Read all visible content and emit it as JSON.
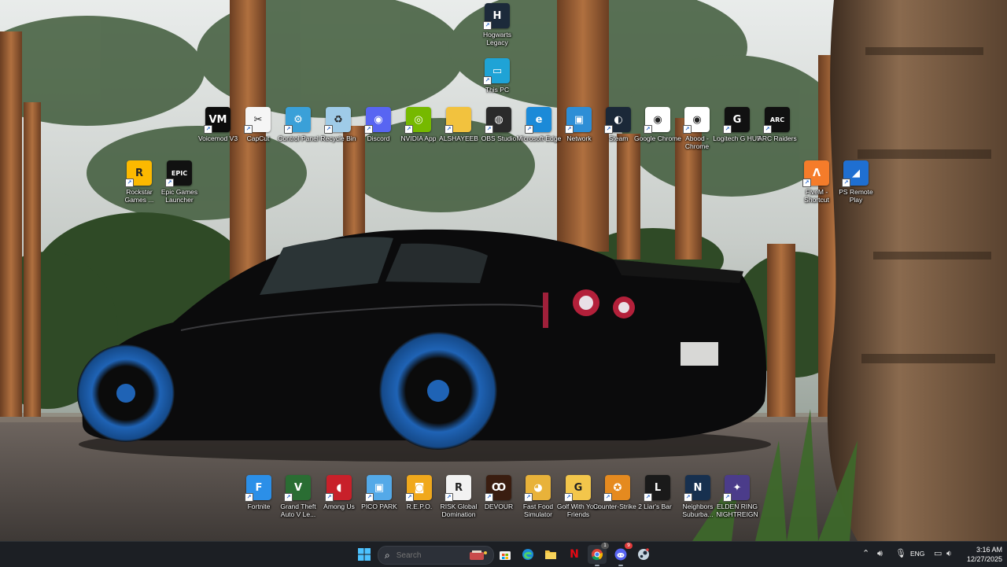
{
  "desktop": {
    "icons": [
      {
        "label": "Hogwarts Legacy",
        "icon": "hogwarts-icon",
        "color": "#1c2a3a",
        "glyph": "H"
      },
      {
        "label": "This PC",
        "icon": "monitor-icon",
        "color": "#1fa3d6",
        "glyph": "▭"
      },
      {
        "label": "Voicemod V3",
        "icon": "voicemod-icon",
        "color": "#0c0c0c",
        "glyph": "VM"
      },
      {
        "label": "CapCut",
        "icon": "capcut-icon",
        "color": "#f5f5f5",
        "glyph": "✂"
      },
      {
        "label": "Control Panel",
        "icon": "control-panel-icon",
        "color": "#3aa0d8",
        "glyph": "⚙"
      },
      {
        "label": "Recycle Bin",
        "icon": "recycle-bin-icon",
        "color": "#9fcbe8",
        "glyph": "♻"
      },
      {
        "label": "Discord",
        "icon": "discord-icon",
        "color": "#5865f2",
        "glyph": "◉"
      },
      {
        "label": "NVIDIA App",
        "icon": "nvidia-icon",
        "color": "#76b900",
        "glyph": "◎"
      },
      {
        "label": "ALSHAYEEB",
        "icon": "folder-icon",
        "color": "#f2c23e",
        "glyph": ""
      },
      {
        "label": "OBS Studio",
        "icon": "obs-icon",
        "color": "#2a2a2a",
        "glyph": "◍"
      },
      {
        "label": "Microsoft Edge",
        "icon": "edge-icon",
        "color": "#1b8ad8",
        "glyph": "e"
      },
      {
        "label": "Network",
        "icon": "network-icon",
        "color": "#2d8ed6",
        "glyph": "▣"
      },
      {
        "label": "Steam",
        "icon": "steam-icon",
        "color": "#1b2838",
        "glyph": "◐"
      },
      {
        "label": "Google Chrome",
        "icon": "chrome-icon",
        "color": "#ffffff",
        "glyph": "◉"
      },
      {
        "label": "Abood - Chrome",
        "icon": "chrome-profile-icon",
        "color": "#ffffff",
        "glyph": "◉"
      },
      {
        "label": "Logitech G HUB",
        "icon": "logitech-icon",
        "color": "#111111",
        "glyph": "G"
      },
      {
        "label": "ARC Raiders",
        "icon": "arc-raiders-icon",
        "color": "#101010",
        "glyph": "ARC"
      },
      {
        "label": "Rockstar Games ...",
        "icon": "rockstar-icon",
        "color": "#fcb900",
        "glyph": "R"
      },
      {
        "label": "Epic Games Launcher",
        "icon": "epic-games-icon",
        "color": "#111111",
        "glyph": "EPIC"
      },
      {
        "label": "FiveM - Shortcut",
        "icon": "fivem-icon",
        "color": "#f57c2a",
        "glyph": "Λ"
      },
      {
        "label": "PS Remote Play",
        "icon": "ps-remote-play-icon",
        "color": "#1f6fd1",
        "glyph": "◢"
      }
    ],
    "games": [
      {
        "label": "Fortnite",
        "icon": "fortnite-icon",
        "color": "#2b8fe8",
        "glyph": "F"
      },
      {
        "label": "Grand Theft Auto V Le...",
        "icon": "gta-v-icon",
        "color": "#2a6d33",
        "glyph": "V"
      },
      {
        "label": "Among Us",
        "icon": "among-us-icon",
        "color": "#c8202a",
        "glyph": "◖"
      },
      {
        "label": "PICO PARK",
        "icon": "pico-park-icon",
        "color": "#54a9e8",
        "glyph": "▣"
      },
      {
        "label": "R.E.P.O.",
        "icon": "repo-icon",
        "color": "#f0a81c",
        "glyph": "◙"
      },
      {
        "label": "RISK Global Domination",
        "icon": "risk-icon",
        "color": "#f2f2f2",
        "glyph": "R"
      },
      {
        "label": "DEVOUR",
        "icon": "devour-icon",
        "color": "#3a1d10",
        "glyph": "Ꝏ"
      },
      {
        "label": "Fast Food Simulator",
        "icon": "fast-food-icon",
        "color": "#e8b23a",
        "glyph": "◕"
      },
      {
        "label": "Golf With Your Friends",
        "icon": "golf-icon",
        "color": "#f3c64b",
        "glyph": "G"
      },
      {
        "label": "Counter-Strike 2",
        "icon": "counter-strike-icon",
        "color": "#e58a1f",
        "glyph": "✪"
      },
      {
        "label": "Liar's Bar",
        "icon": "liars-bar-icon",
        "color": "#1a1a1a",
        "glyph": "L"
      },
      {
        "label": "Neighbors Suburba...",
        "icon": "neighbors-icon",
        "color": "#17304f",
        "glyph": "N"
      },
      {
        "label": "ELDEN RING NIGHTREIGN",
        "icon": "elden-ring-icon",
        "color": "#4b3c8a",
        "glyph": "✦"
      }
    ]
  },
  "taskbar": {
    "search_placeholder": "Search",
    "apps": [
      {
        "name": "start-button",
        "glyph": "⊞",
        "color": "#4cc2ff"
      },
      {
        "name": "taskbar-store",
        "glyph": "▦",
        "color": "#e8e8e8"
      },
      {
        "name": "taskbar-edge",
        "glyph": "e",
        "color": "#1fa3f0"
      },
      {
        "name": "taskbar-file-explorer",
        "glyph": "▬",
        "color": "#f2c23e"
      },
      {
        "name": "taskbar-netflix",
        "glyph": "N",
        "color": "#e50914"
      },
      {
        "name": "taskbar-chrome",
        "glyph": "◉",
        "color": "#34a853"
      },
      {
        "name": "taskbar-discord",
        "glyph": "◉",
        "color": "#5865f2"
      },
      {
        "name": "taskbar-steam",
        "glyph": "◐",
        "color": "#c7d5e0"
      }
    ],
    "chrome_badge": "1",
    "discord_badge": "9",
    "tray": {
      "language": "ENG",
      "time": "3:16 AM",
      "date": "12/27/2025"
    }
  }
}
